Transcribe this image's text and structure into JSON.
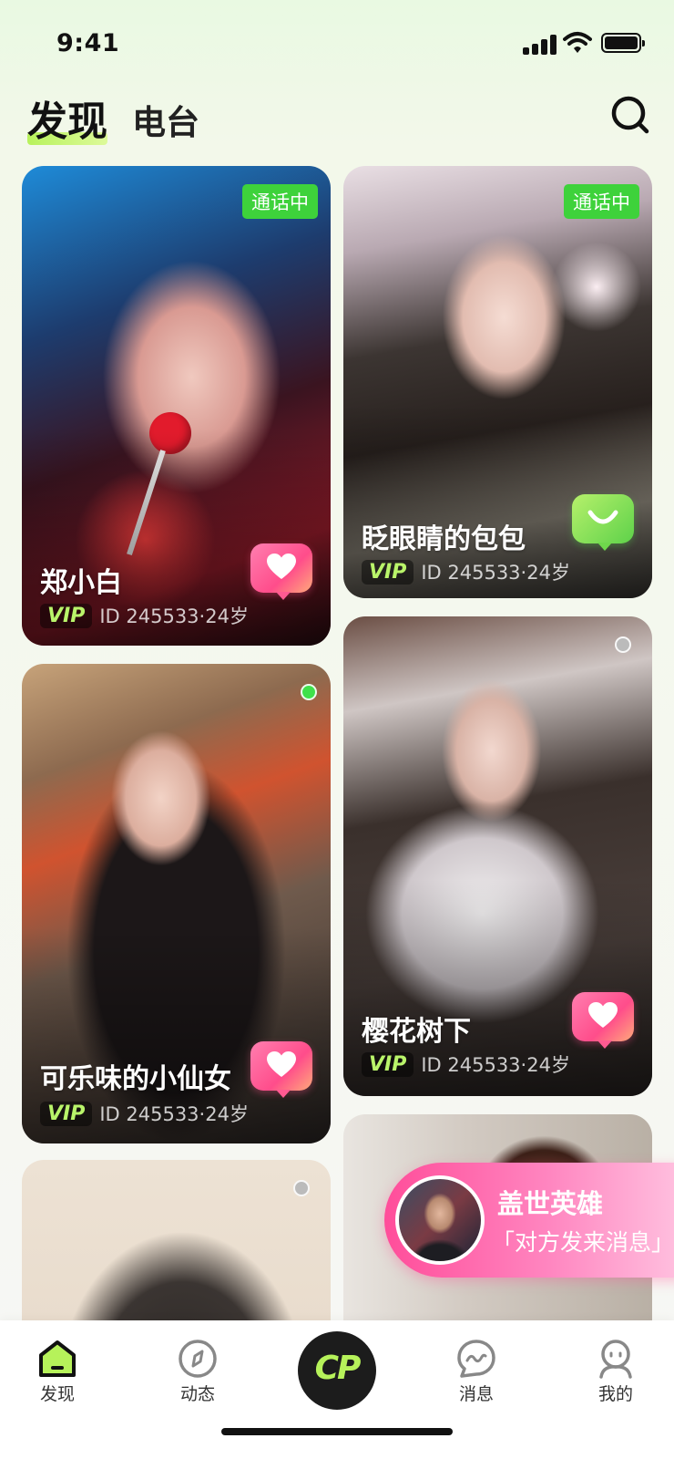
{
  "status_bar": {
    "time": "9:41"
  },
  "header": {
    "tabs": [
      {
        "label": "发现",
        "active": true
      },
      {
        "label": "电台",
        "active": false
      }
    ]
  },
  "cards": [
    {
      "name": "郑小白",
      "vip": "VIP",
      "meta": "ID 245533·24岁",
      "status_badge": "通话中",
      "action": "like"
    },
    {
      "name": "眨眼睛的包包",
      "vip": "VIP",
      "meta": "ID 245533·24岁",
      "status_badge": "通话中",
      "action": "chat"
    },
    {
      "name": "可乐味的小仙女",
      "vip": "VIP",
      "meta": "ID 245533·24岁",
      "online": true,
      "action": "like"
    },
    {
      "name": "樱花树下",
      "vip": "VIP",
      "meta": "ID 245533·24岁",
      "online": false,
      "action": "like"
    },
    {
      "online": false
    },
    {}
  ],
  "toast": {
    "name": "盖世英雄",
    "message": "「对方发来消息」"
  },
  "bottom_nav": {
    "items": [
      {
        "label": "发现",
        "icon": "home-icon",
        "active": true
      },
      {
        "label": "动态",
        "icon": "compass-icon"
      },
      {
        "label": "CP",
        "icon": "cp-icon"
      },
      {
        "label": "消息",
        "icon": "message-icon"
      },
      {
        "label": "我的",
        "icon": "profile-icon"
      }
    ]
  },
  "colors": {
    "accent_green": "#b6f25a",
    "call_badge": "#3ed23b",
    "like_pink": "#ff4d8b",
    "online": "#3fe04a"
  }
}
